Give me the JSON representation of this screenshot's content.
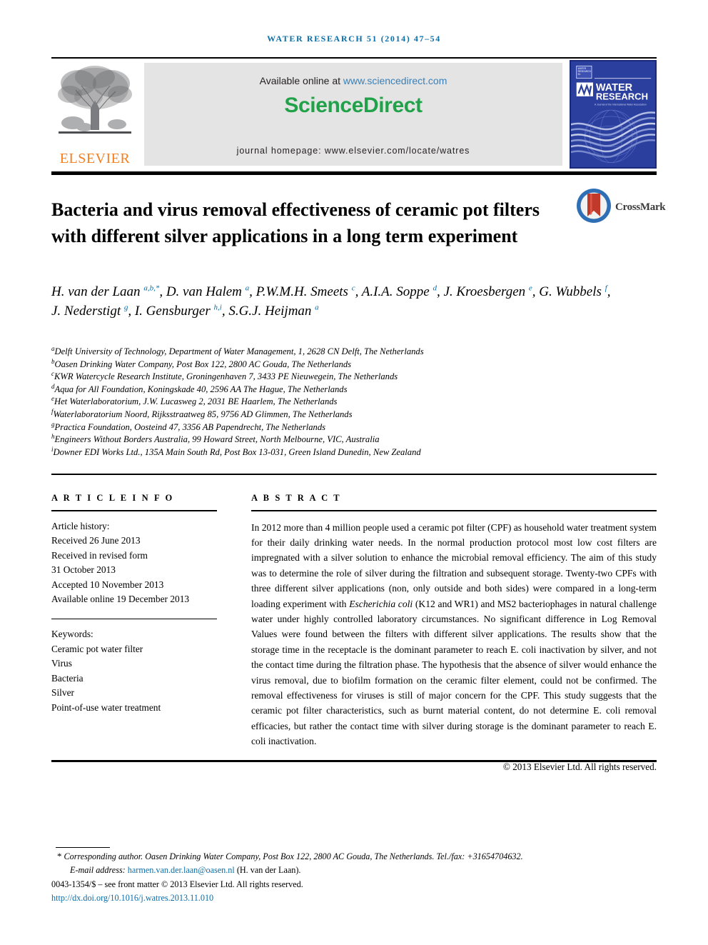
{
  "running_head": "WATER RESEARCH 51 (2014) 47–54",
  "banner": {
    "available_prefix": "Available online at ",
    "available_link": "www.sciencedirect.com",
    "sciencedirect_logo": "ScienceDirect",
    "journal_homepage": "journal homepage: www.elsevier.com/locate/watres",
    "elsevier_wordmark": "ELSEVIER",
    "cover": {
      "title_line1": "WATER",
      "title_line2": "RESEARCH",
      "iwa_logo": "IWA",
      "subtitle": "A Journal of the International Water Association"
    }
  },
  "crossmark": {
    "label": "CrossMark"
  },
  "title": "Bacteria and virus removal effectiveness of ceramic pot filters with different silver applications in a long term experiment",
  "authors_html": "H. van der Laan <sup>a,b,*</sup>, D. van Halem <sup>a</sup>, P.W.M.H. Smeets <sup>c</sup>, A.I.A. Soppe <sup>d</sup>, J. Kroesbergen <sup>e</sup>, G. Wubbels <sup>f</sup>, J. Nederstigt <sup>g</sup>, I. Gensburger <sup>h,i</sup>, S.G.J. Heijman <sup>a</sup>",
  "affiliations": [
    {
      "marker": "a",
      "text": "Delft University of Technology, Department of Water Management, 1, 2628 CN Delft, The Netherlands"
    },
    {
      "marker": "b",
      "text": "Oasen Drinking Water Company, Post Box 122, 2800 AC Gouda, The Netherlands"
    },
    {
      "marker": "c",
      "text": "KWR Watercycle Research Institute, Groningenhaven 7, 3433 PE Nieuwegein, The Netherlands"
    },
    {
      "marker": "d",
      "text": "Aqua for All Foundation, Koningskade 40, 2596 AA The Hague, The Netherlands"
    },
    {
      "marker": "e",
      "text": "Het Waterlaboratorium, J.W. Lucasweg 2, 2031 BE Haarlem, The Netherlands"
    },
    {
      "marker": "f",
      "text": "Waterlaboratorium Noord, Rijksstraatweg 85, 9756 AD Glimmen, The Netherlands"
    },
    {
      "marker": "g",
      "text": "Practica Foundation, Oosteind 47, 3356 AB Papendrecht, The Netherlands"
    },
    {
      "marker": "h",
      "text": "Engineers Without Borders Australia, 99 Howard Street, North Melbourne, VIC, Australia"
    },
    {
      "marker": "i",
      "text": "Downer EDI Works Ltd., 135A Main South Rd, Post Box 13-031, Green Island Dunedin, New Zealand"
    }
  ],
  "article_info": {
    "heading": "A R T I C L E   I N F O",
    "history_label": "Article history:",
    "history": [
      "Received 26 June 2013",
      "Received in revised form",
      "31 October 2013",
      "Accepted 10 November 2013",
      "Available online 19 December 2013"
    ],
    "keywords_label": "Keywords:",
    "keywords": [
      "Ceramic pot water filter",
      "Virus",
      "Bacteria",
      "Silver",
      "Point-of-use water treatment"
    ]
  },
  "abstract": {
    "heading": "A B S T R A C T",
    "body_html": "In 2012 more than 4 million people used a ceramic pot filter (CPF) as household water treatment system for their daily drinking water needs. In the normal production protocol most low cost filters are impregnated with a silver solution to enhance the microbial removal efficiency. The aim of this study was to determine the role of silver during the filtration and subsequent storage. Twenty-two CPFs with three different silver applications (non, only outside and both sides) were compared in a long-term loading experiment with <i>Escherichia coli</i> (K12 and WR1) and MS2 bacteriophages in natural challenge water under highly controlled laboratory circumstances. No significant difference in Log Removal Values were found between the filters with different silver applications. The results show that the storage time in the receptacle is the dominant parameter to reach E. coli inactivation by silver, and not the contact time during the filtration phase. The hypothesis that the absence of silver would enhance the virus removal, due to biofilm formation on the ceramic filter element, could not be confirmed. The removal effectiveness for viruses is still of major concern for the CPF. This study suggests that the ceramic pot filter characteristics, such as burnt material content, do not determine E. coli removal efficacies, but rather the contact time with silver during storage is the dominant parameter to reach E. coli inactivation.",
    "copyright": "© 2013 Elsevier Ltd. All rights reserved."
  },
  "footer": {
    "corresponding_star": "*",
    "corresponding_text": "Corresponding author. Oasen Drinking Water Company, Post Box 122, 2800 AC Gouda, The Netherlands. Tel./fax: +31654704632.",
    "email_label": "E-mail address:",
    "email": "harmen.van.der.laan@oasen.nl",
    "email_owner": "(H. van der Laan).",
    "issn_line": "0043-1354/$ – see front matter © 2013 Elsevier Ltd. All rights reserved.",
    "doi": "http://dx.doi.org/10.1016/j.watres.2013.11.010"
  },
  "colors": {
    "link_blue": "#0a6ea8",
    "sciencedirect_green": "#21a24a",
    "elsevier_orange": "#f47f20",
    "cover_blue": "#2b3f9e"
  }
}
